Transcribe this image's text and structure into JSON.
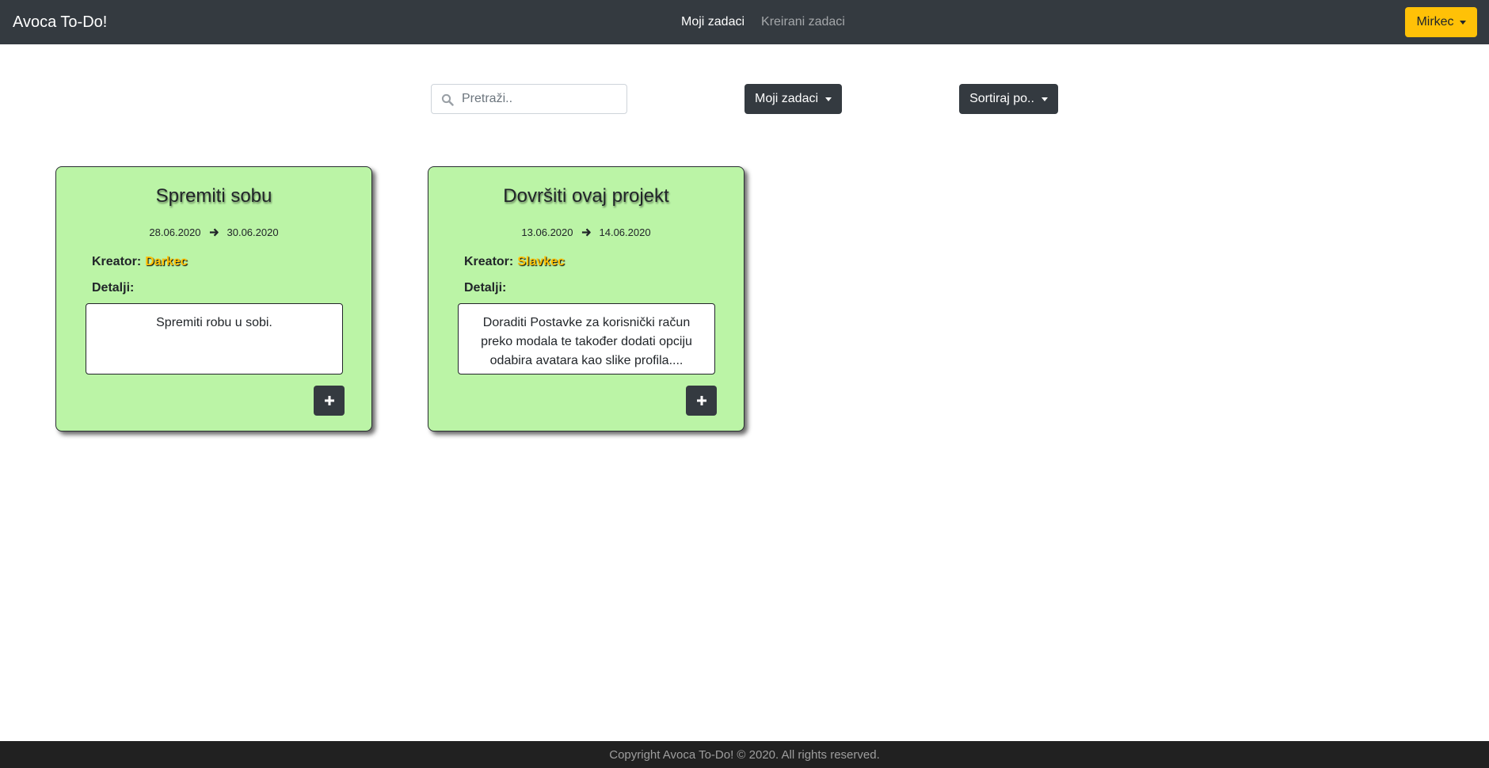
{
  "navbar": {
    "brand": "Avoca To-Do!",
    "links": [
      {
        "label": "Moji zadaci",
        "active": true
      },
      {
        "label": "Kreirani zadaci",
        "active": false
      }
    ],
    "user_button": "Mirkec"
  },
  "controls": {
    "search_placeholder": "Pretraži..",
    "search_value": "",
    "filter_label": "Moji zadaci",
    "sort_label": "Sortiraj po.."
  },
  "labels": {
    "creator": "Kreator:",
    "details": "Detalji:"
  },
  "tasks": [
    {
      "title": "Spremiti sobu",
      "start_date": "28.06.2020",
      "end_date": "30.06.2020",
      "creator": "Darkec",
      "details": "Spremiti robu u sobi."
    },
    {
      "title": "Dovršiti ovaj projekt",
      "start_date": "13.06.2020",
      "end_date": "14.06.2020",
      "creator": "Slavkec",
      "details": "Doraditi Postavke za korisnički račun preko modala te također dodati opciju odabira avatara kao slike profila...."
    }
  ],
  "footer": {
    "copyright": "Copyright Avoca To-Do! © 2020. All rights reserved."
  },
  "colors": {
    "navbar_bg": "#343a40",
    "accent_yellow": "#ffc107",
    "card_bg": "#bbf4a6",
    "footer_bg": "#212121"
  },
  "icons": {
    "search": "search-icon",
    "date_arrow": "arrow-right-icon",
    "add": "plus-icon",
    "dropdown": "caret-down-icon"
  }
}
